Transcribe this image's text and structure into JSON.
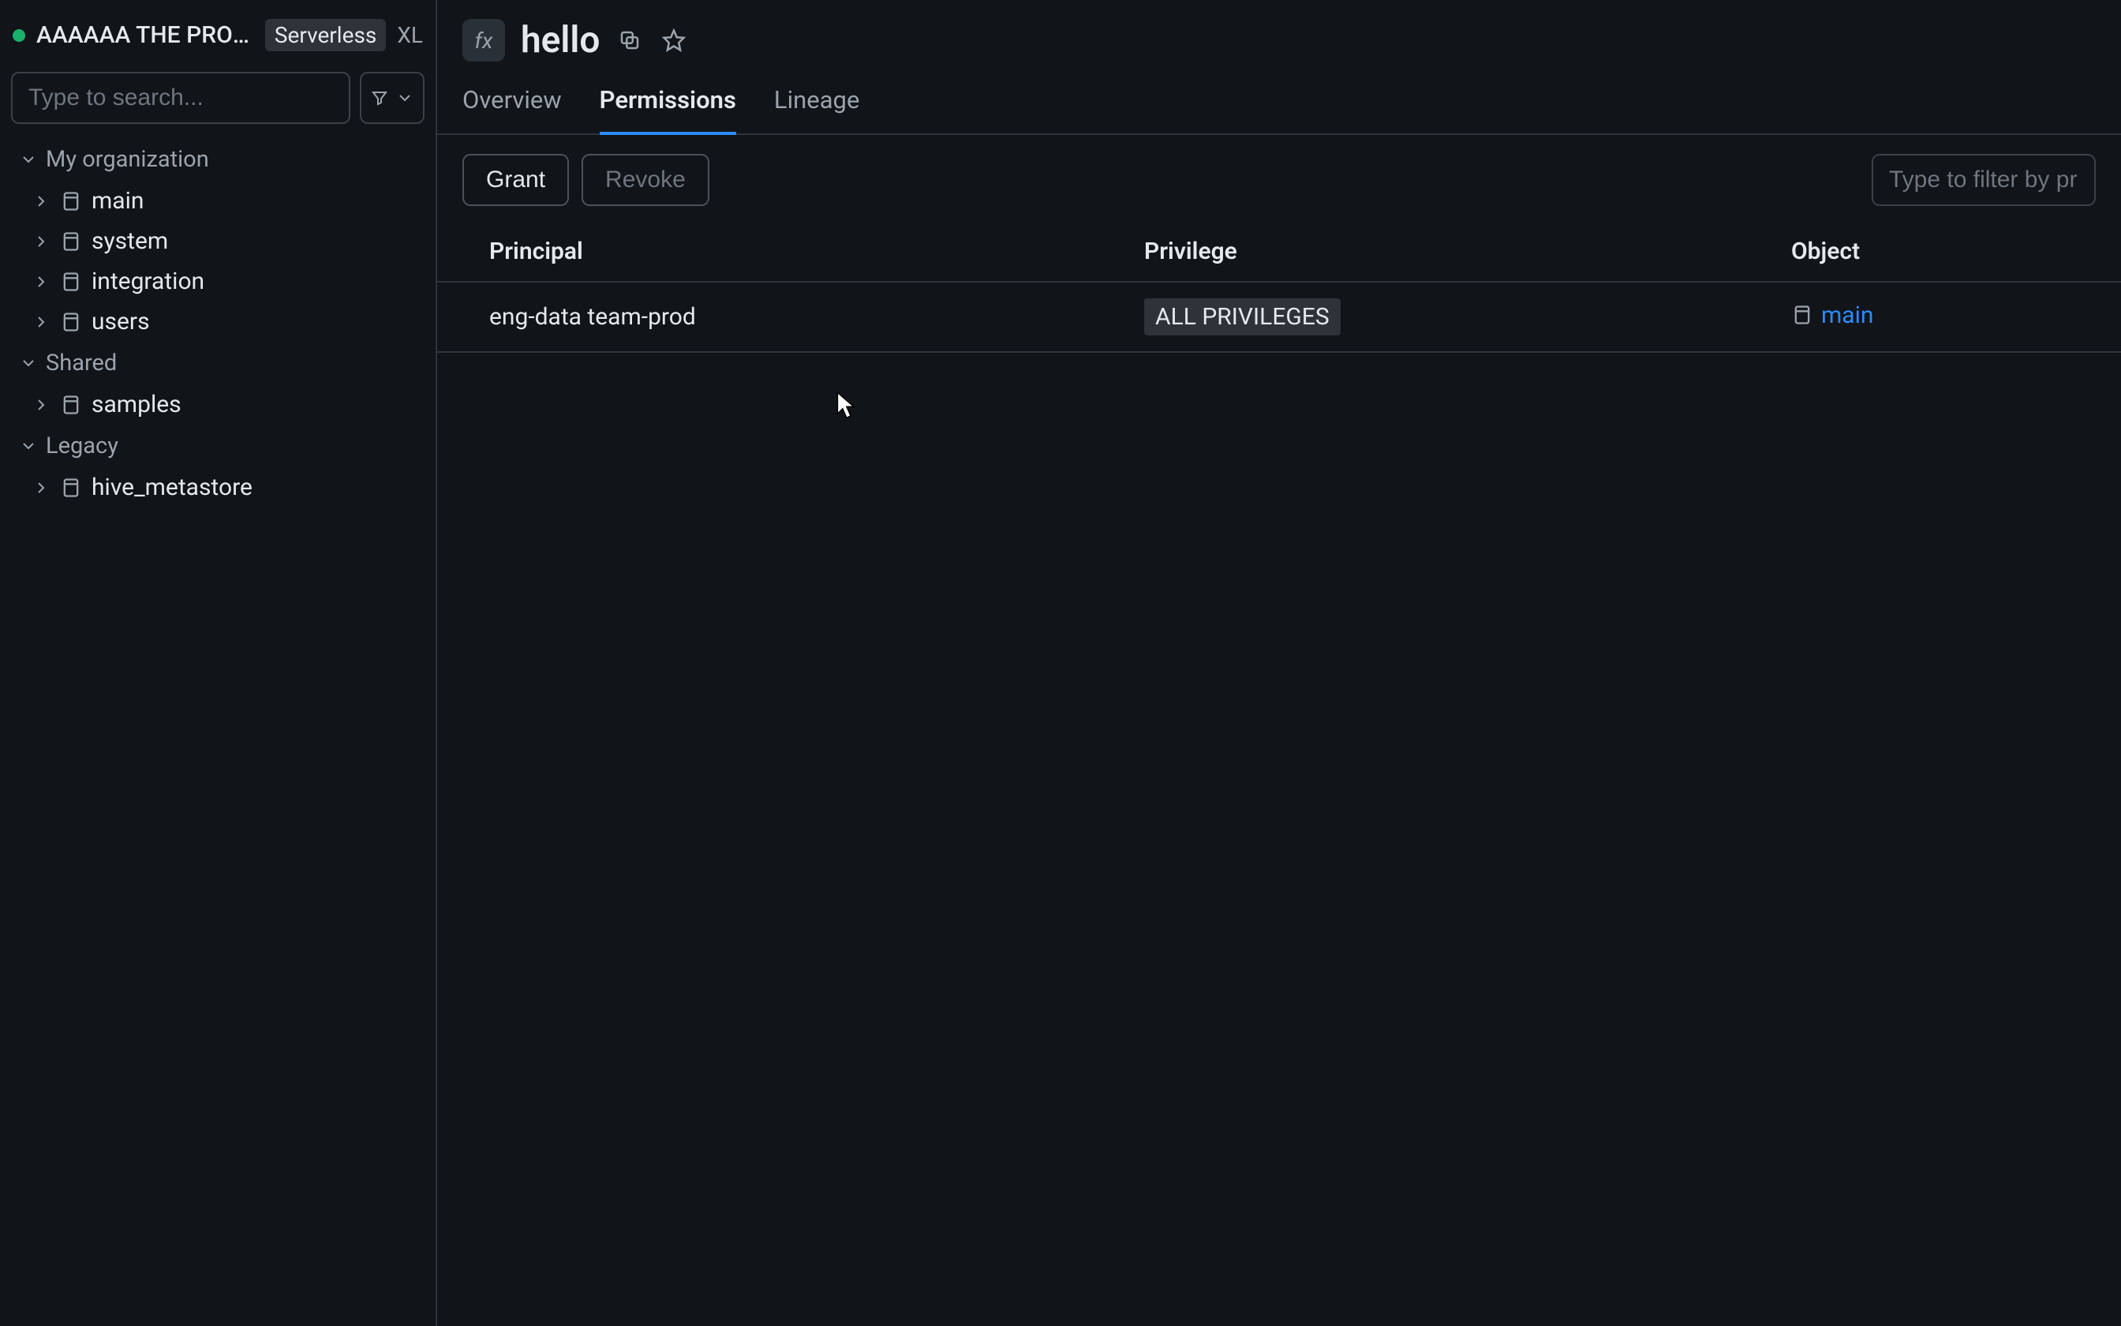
{
  "workspace": {
    "name": "AAAAAA THE PRODU…",
    "badge": "Serverless",
    "size": "XL"
  },
  "search": {
    "placeholder": "Type to search..."
  },
  "tree": {
    "sections": [
      {
        "label": "My organization",
        "items": [
          {
            "label": "main"
          },
          {
            "label": "system"
          },
          {
            "label": "integration"
          },
          {
            "label": "users"
          }
        ]
      },
      {
        "label": "Shared",
        "items": [
          {
            "label": "samples"
          }
        ]
      },
      {
        "label": "Legacy",
        "items": [
          {
            "label": "hive_metastore"
          }
        ]
      }
    ]
  },
  "header": {
    "fx": "fx",
    "title": "hello"
  },
  "tabs": [
    {
      "label": "Overview"
    },
    {
      "label": "Permissions"
    },
    {
      "label": "Lineage"
    }
  ],
  "active_tab": 1,
  "toolbar": {
    "grant": "Grant",
    "revoke": "Revoke",
    "filter_placeholder": "Type to filter by pr"
  },
  "table": {
    "columns": {
      "principal": "Principal",
      "privilege": "Privilege",
      "object": "Object"
    },
    "rows": [
      {
        "principal": "eng-data team-prod",
        "privilege": "ALL PRIVILEGES",
        "object": "main"
      }
    ]
  }
}
